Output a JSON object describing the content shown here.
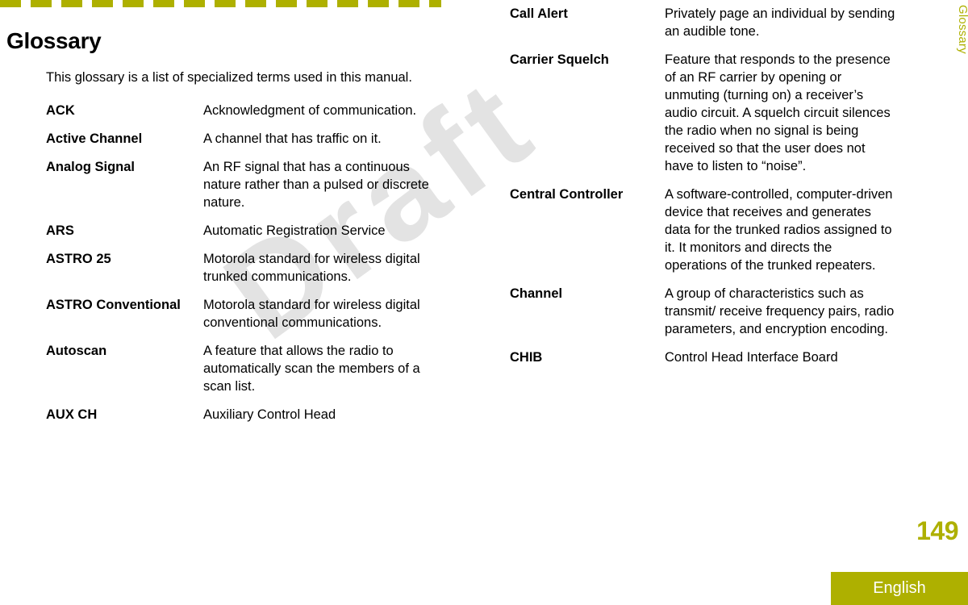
{
  "page": {
    "title": "Glossary",
    "intro": "This glossary is a list of specialized terms used in this manual.",
    "page_number": "149",
    "language": "English",
    "side_tab": "Glossary",
    "watermark": "Draft",
    "accent_color": "#aeb000",
    "watermark_color": "#e3e3e3"
  },
  "columns": {
    "left": [
      {
        "term": "ACK",
        "definition": "Acknowledgment of communication."
      },
      {
        "term": "Active Channel",
        "definition": "A channel that has traffic on it."
      },
      {
        "term": "Analog Signal",
        "definition": "An RF signal that has a continuous nature rather than a pulsed or discrete nature."
      },
      {
        "term": "ARS",
        "definition": "Automatic Registration Service"
      },
      {
        "term": "ASTRO 25",
        "definition": "Motorola standard for wireless digital trunked communications."
      },
      {
        "term": "ASTRO Conventional",
        "definition": "Motorola standard for wireless digital conventional communications."
      },
      {
        "term": "Autoscan",
        "definition": "A feature that allows the radio to automatically scan the members of a scan list."
      },
      {
        "term": "AUX CH",
        "definition": "Auxiliary Control Head"
      }
    ],
    "right": [
      {
        "term": "Call Alert",
        "definition": "Privately page an individual by sending an audible tone."
      },
      {
        "term": "Carrier Squelch",
        "definition": "Feature that responds to the presence of an RF carrier by opening or unmuting (turning on) a receiver’s audio circuit. A squelch circuit silences the radio when no signal is being received so that the user does not have to listen to “noise”."
      },
      {
        "term": "Central Controller",
        "definition": "A software-controlled, computer-driven device that receives and generates data for the trunked radios assigned to it. It monitors and directs the operations of the trunked repeaters."
      },
      {
        "term": "Channel",
        "definition": "A group of characteristics such as transmit/ receive frequency pairs, radio parameters, and encryption encoding."
      },
      {
        "term": "CHIB",
        "definition": "Control Head Interface Board"
      }
    ]
  }
}
